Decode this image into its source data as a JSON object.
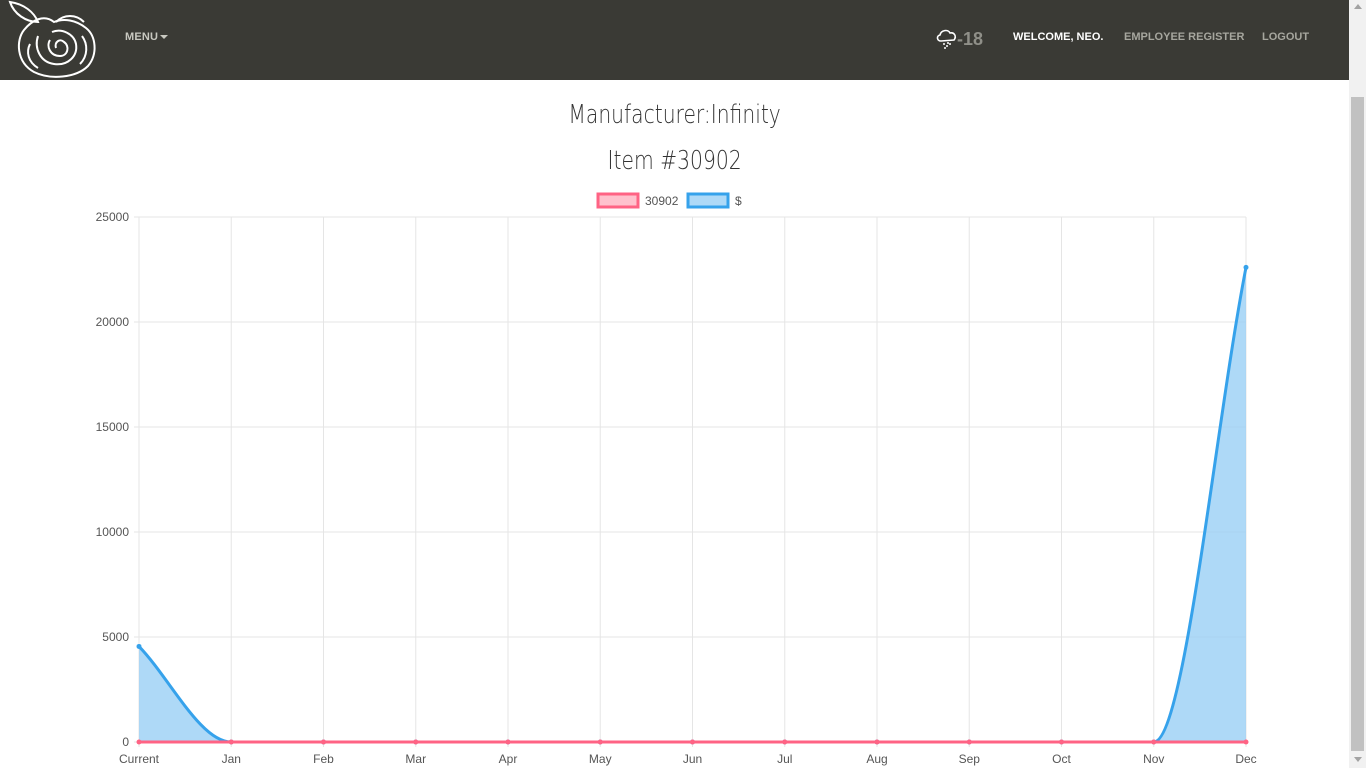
{
  "nav": {
    "menu_label": "MENU",
    "weather_temp": "-18",
    "weather_icon": "cloud-snow-icon",
    "welcome": "WELCOME, NEO.",
    "employee_register": "EMPLOYEE REGISTER",
    "logout": "LOGOUT"
  },
  "header": {
    "manufacturer": "Manufacturer:Infinity",
    "item": "Item #30902"
  },
  "chart_data": {
    "type": "line",
    "categories": [
      "Current",
      "Jan",
      "Feb",
      "Mar",
      "Apr",
      "May",
      "Jun",
      "Jul",
      "Aug",
      "Sep",
      "Oct",
      "Nov",
      "Dec"
    ],
    "series": [
      {
        "name": "30902",
        "color": "#ff6384",
        "fill": "#ffb1c1",
        "values": [
          0,
          0,
          0,
          0,
          0,
          0,
          0,
          0,
          0,
          0,
          0,
          0,
          0
        ]
      },
      {
        "name": "$",
        "color": "#36a2eb",
        "fill": "#9ad0f5",
        "values": [
          4550,
          0,
          0,
          0,
          0,
          0,
          0,
          0,
          0,
          0,
          0,
          0,
          22600
        ]
      }
    ],
    "ylim": [
      0,
      25000
    ],
    "yticks": [
      0,
      5000,
      10000,
      15000,
      20000,
      25000
    ],
    "legend": "top",
    "grid": true
  }
}
